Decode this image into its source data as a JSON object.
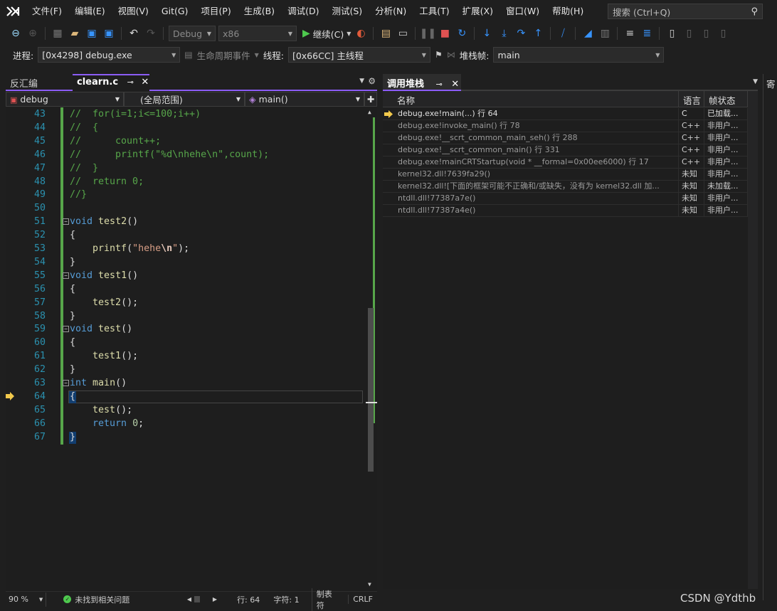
{
  "menu": {
    "items": [
      "文件(F)",
      "编辑(E)",
      "视图(V)",
      "Git(G)",
      "项目(P)",
      "生成(B)",
      "调试(D)",
      "测试(S)",
      "分析(N)",
      "工具(T)",
      "扩展(X)",
      "窗口(W)",
      "帮助(H)"
    ],
    "search_placeholder": "搜索 (Ctrl+Q)"
  },
  "toolbar": {
    "config": "Debug",
    "platform": "x86",
    "continue_label": "继续(C)"
  },
  "debug_bar": {
    "process_label": "进程:",
    "process_value": "[0x4298] debug.exe",
    "lifecycle_label": "生命周期事件",
    "thread_label": "线程:",
    "thread_value": "[0x66CC] 主线程",
    "stackframe_label": "堆栈帧:",
    "stackframe_value": "main"
  },
  "editor": {
    "tabs": [
      {
        "label": "反汇编",
        "active": false
      },
      {
        "label": "clearn.c",
        "active": true
      }
    ],
    "nav": {
      "project": "debug",
      "scope": "(全局范围)",
      "member": "main()"
    },
    "lines": [
      {
        "n": "43",
        "html": "<span class='cm'>//  for(i=1;i&lt;=100;i++)</span>"
      },
      {
        "n": "44",
        "html": "<span class='cm'>//  {</span>"
      },
      {
        "n": "45",
        "html": "<span class='cm'>//      count++;</span>"
      },
      {
        "n": "46",
        "html": "<span class='cm'>//      printf(\"%d\\nhehe\\n\",count);</span>"
      },
      {
        "n": "47",
        "html": "<span class='cm'>//  }</span>"
      },
      {
        "n": "48",
        "html": "<span class='cm'>//  return 0;</span>"
      },
      {
        "n": "49",
        "html": "<span class='cm'>//}</span>"
      },
      {
        "n": "50",
        "html": ""
      },
      {
        "n": "51",
        "html": "<span class='kw'>void</span> <span class='fn'>test2</span>()"
      },
      {
        "n": "52",
        "html": "{"
      },
      {
        "n": "53",
        "html": "    <span class='fn'>printf</span>(<span class='str'>\"hehe</span><span class='esc'>\\n</span><span class='str'>\"</span>);"
      },
      {
        "n": "54",
        "html": "}"
      },
      {
        "n": "55",
        "html": "<span class='kw'>void</span> <span class='fn'>test1</span>()"
      },
      {
        "n": "56",
        "html": "{"
      },
      {
        "n": "57",
        "html": "    <span class='fn'>test2</span>();"
      },
      {
        "n": "58",
        "html": "}"
      },
      {
        "n": "59",
        "html": "<span class='kw'>void</span> <span class='fn'>test</span>()"
      },
      {
        "n": "60",
        "html": "{"
      },
      {
        "n": "61",
        "html": "    <span class='fn'>test1</span>();"
      },
      {
        "n": "62",
        "html": "}"
      },
      {
        "n": "63",
        "html": "<span class='kw'>int</span> <span class='fn'>main</span>()"
      },
      {
        "n": "64",
        "html": "{"
      },
      {
        "n": "65",
        "html": "    <span class='fn'>test</span>();"
      },
      {
        "n": "66",
        "html": "    <span class='kw'>return</span> <span class='num'>0</span>;"
      },
      {
        "n": "67",
        "html": "}"
      }
    ]
  },
  "status": {
    "zoom": "90 %",
    "issues": "未找到相关问题",
    "line": "行: 64",
    "char": "字符: 1",
    "tabs": "制表符",
    "eol": "CRLF"
  },
  "callstack": {
    "tab_label": "调用堆栈",
    "headers": {
      "name": "名称",
      "lang": "语言",
      "state": "帧状态"
    },
    "rows": [
      {
        "name": "debug.exe!main(...) 行 64",
        "lang": "C",
        "state": "已加载..."
      },
      {
        "name": "debug.exe!invoke_main() 行 78",
        "lang": "C++",
        "state": "非用户..."
      },
      {
        "name": "debug.exe!__scrt_common_main_seh() 行 288",
        "lang": "C++",
        "state": "非用户..."
      },
      {
        "name": "debug.exe!__scrt_common_main() 行 331",
        "lang": "C++",
        "state": "非用户..."
      },
      {
        "name": "debug.exe!mainCRTStartup(void * __formal=0x00ee6000) 行 17",
        "lang": "C++",
        "state": "非用户..."
      },
      {
        "name": "kernel32.dll!7639fa29()",
        "lang": "未知",
        "state": "非用户..."
      },
      {
        "name": "kernel32.dll![下面的框架可能不正确和/或缺失，没有为 kernel32.dll 加...",
        "lang": "未知",
        "state": "未加载..."
      },
      {
        "name": "ntdll.dll!77387a7e()",
        "lang": "未知",
        "state": "非用户..."
      },
      {
        "name": "ntdll.dll!77387a4e()",
        "lang": "未知",
        "state": "非用户..."
      }
    ]
  },
  "right_edge": {
    "title": "寄"
  },
  "watermark": "CSDN @Ydthb",
  "colors": {
    "accent": "#8b5cf6",
    "change_bar": "#57a64a",
    "breakpoint_arrow": "#f2c94c"
  }
}
